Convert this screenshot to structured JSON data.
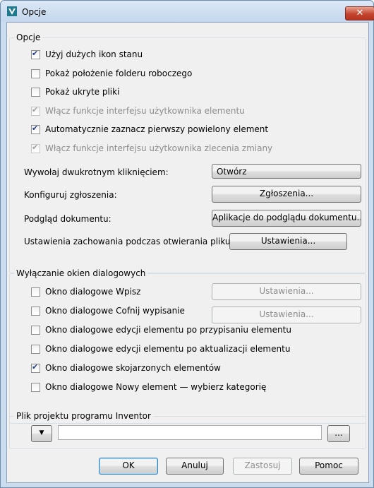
{
  "window": {
    "title": "Opcje",
    "close_label": "✕"
  },
  "options_group": {
    "title": "Opcje",
    "checkboxes": [
      {
        "label": "Użyj dużych ikon stanu",
        "checked": true,
        "enabled": true
      },
      {
        "label": "Pokaż położenie folderu roboczego",
        "checked": false,
        "enabled": true
      },
      {
        "label": "Pokaż ukryte pliki",
        "checked": false,
        "enabled": true
      },
      {
        "label": "Włącz funkcje interfejsu użytkownika elementu",
        "checked": true,
        "enabled": false
      },
      {
        "label": "Automatycznie zaznacz pierwszy powielony element",
        "checked": true,
        "enabled": true
      },
      {
        "label": "Włącz funkcje interfejsu użytkownika zlecenia zmiany",
        "checked": true,
        "enabled": false
      }
    ],
    "double_click_label": "Wywołaj dwukrotnym kliknięciem:",
    "double_click_value": "Otwórz",
    "configure_label": "Konfiguruj zgłoszenia:",
    "configure_button": "Zgłoszenia...",
    "preview_label": "Podgląd dokumentu:",
    "preview_button": "Aplikacje do podglądu dokumentu...",
    "open_behavior_label": "Ustawienia zachowania podczas otwierania pliku:",
    "open_behavior_button": "Ustawienia..."
  },
  "dialogs_group": {
    "title": "Wyłączanie okien dialogowych",
    "checkboxes": [
      {
        "label": "Okno dialogowe Wpisz",
        "checked": false
      },
      {
        "label": "Okno dialogowe Cofnij wypisanie",
        "checked": false
      },
      {
        "label": "Okno dialogowe edycji elementu po przypisaniu elementu",
        "checked": false
      },
      {
        "label": "Okno dialogowe edycji elementu po aktualizacji elementu",
        "checked": false
      },
      {
        "label": "Okno dialogowe skojarzonych elementów",
        "checked": true
      },
      {
        "label": "Okno dialogowe Nowy element — wybierz kategorię",
        "checked": false
      }
    ],
    "settings_button": "Ustawienia..."
  },
  "project_group": {
    "title": "Plik projektu programu Inventor",
    "dropdown_icon": "▼",
    "path_value": "",
    "browse_label": "..."
  },
  "footer": {
    "ok": "OK",
    "cancel": "Anuluj",
    "apply": "Zastosuj",
    "help": "Pomoc"
  },
  "colors": {
    "accent": "#3c7fb1",
    "check": "#233d84",
    "disabled_text": "#8d8d8d"
  }
}
